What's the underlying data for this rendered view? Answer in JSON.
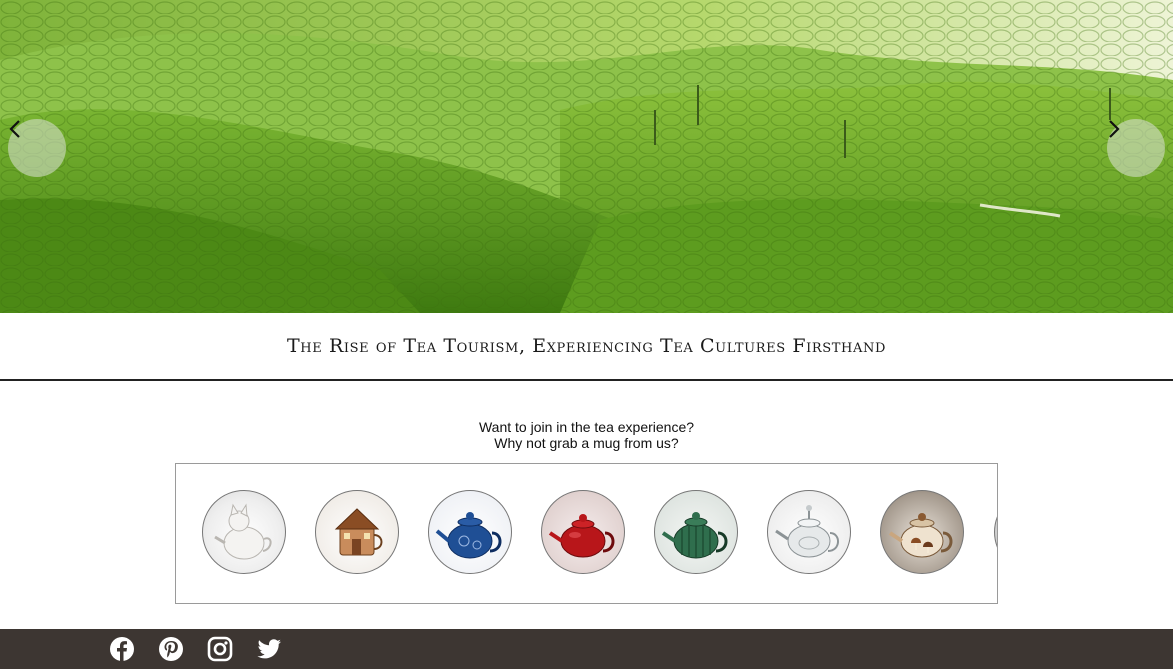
{
  "hero": {
    "prev_icon": "chevron-left-icon",
    "next_icon": "chevron-right-icon"
  },
  "article": {
    "title": "The Rise of Tea Tourism, Experiencing Tea Cultures Firsthand"
  },
  "promo": {
    "line1": "Want to join in the tea experience?",
    "line2": "Why not grab a mug from us?"
  },
  "products": [
    {
      "name": "cat-teapot",
      "color": "#e8e6e2"
    },
    {
      "name": "cottage-teapot",
      "color": "#b7774a"
    },
    {
      "name": "blue-porcelain-teapot",
      "color": "#1f4f95"
    },
    {
      "name": "red-teapot",
      "color": "#b8161a"
    },
    {
      "name": "green-teapot",
      "color": "#2f6e4d"
    },
    {
      "name": "glass-teapot",
      "color": "#d9dcdd"
    },
    {
      "name": "mushroom-teapot",
      "color": "#c9a67f"
    }
  ],
  "footer": {
    "social": [
      "facebook-icon",
      "pinterest-icon",
      "instagram-icon",
      "twitter-icon"
    ],
    "background": "#3d3632"
  }
}
